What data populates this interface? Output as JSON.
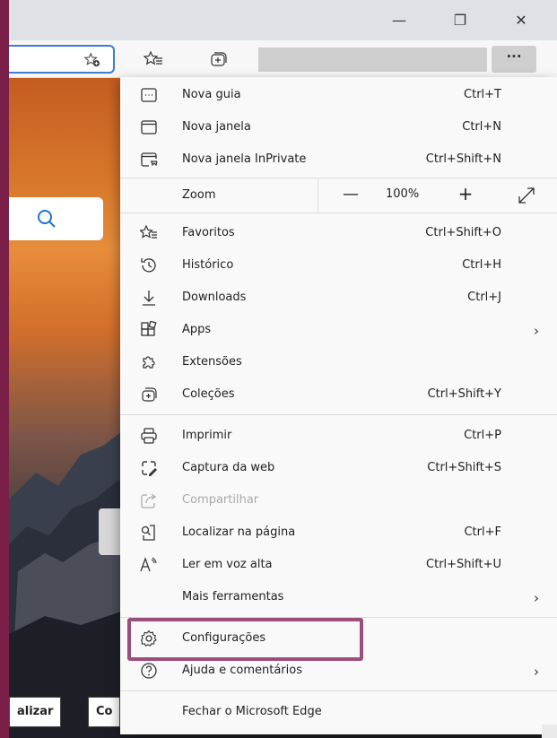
{
  "window": {
    "minimize": "—",
    "restore": "❐",
    "close": "✕"
  },
  "toolbar": {
    "more_label": "···"
  },
  "page": {
    "btn1": "alizar",
    "btn2": "Co"
  },
  "zoom": {
    "label": "Zoom",
    "minus": "—",
    "value": "100%",
    "plus": "+"
  },
  "menu": [
    {
      "label": "Nova guia",
      "shortcut": "Ctrl+T",
      "icon": "new-tab-icon"
    },
    {
      "label": "Nova janela",
      "shortcut": "Ctrl+N",
      "icon": "new-window-icon"
    },
    {
      "label": "Nova janela InPrivate",
      "shortcut": "Ctrl+Shift+N",
      "icon": "inprivate-icon"
    },
    {
      "label": "Favoritos",
      "shortcut": "Ctrl+Shift+O",
      "icon": "favorites-icon"
    },
    {
      "label": "Histórico",
      "shortcut": "Ctrl+H",
      "icon": "history-icon"
    },
    {
      "label": "Downloads",
      "shortcut": "Ctrl+J",
      "icon": "download-icon"
    },
    {
      "label": "Apps",
      "shortcut": "",
      "icon": "apps-icon",
      "submenu": true
    },
    {
      "label": "Extensões",
      "shortcut": "",
      "icon": "extensions-icon"
    },
    {
      "label": "Coleções",
      "shortcut": "Ctrl+Shift+Y",
      "icon": "collections-icon"
    },
    {
      "label": "Imprimir",
      "shortcut": "Ctrl+P",
      "icon": "print-icon"
    },
    {
      "label": "Captura da web",
      "shortcut": "Ctrl+Shift+S",
      "icon": "web-capture-icon"
    },
    {
      "label": "Compartilhar",
      "shortcut": "",
      "icon": "share-icon",
      "disabled": true
    },
    {
      "label": "Localizar na página",
      "shortcut": "Ctrl+F",
      "icon": "find-icon"
    },
    {
      "label": "Ler em voz alta",
      "shortcut": "Ctrl+Shift+U",
      "icon": "read-aloud-icon"
    },
    {
      "label": "Mais ferramentas",
      "shortcut": "",
      "icon": "",
      "submenu": true
    },
    {
      "label": "Configurações",
      "shortcut": "",
      "icon": "settings-icon"
    },
    {
      "label": "Ajuda e comentários",
      "shortcut": "",
      "icon": "help-icon",
      "submenu": true
    },
    {
      "label": "Fechar o Microsoft Edge",
      "shortcut": "",
      "icon": ""
    }
  ],
  "chevron": "›",
  "colors": {
    "highlight": "#9b4d7b",
    "accent": "#3f7ad8",
    "frame": "#7a1f48"
  }
}
